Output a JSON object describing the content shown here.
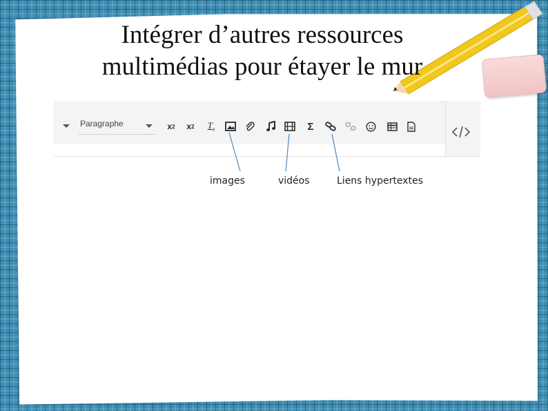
{
  "slide": {
    "title_line1": "Intégrer d’autres ressources",
    "title_line2": "multimédias pour étayer le mur"
  },
  "toolbar": {
    "format_select_value": "Paragraphe",
    "buttons": [
      {
        "name": "subscript",
        "label": "x₂"
      },
      {
        "name": "superscript",
        "label": "x²"
      },
      {
        "name": "clear-format",
        "label": "Tx"
      },
      {
        "name": "image",
        "icon": "image-icon"
      },
      {
        "name": "attachment",
        "icon": "paperclip-icon"
      },
      {
        "name": "audio",
        "icon": "music-note-icon"
      },
      {
        "name": "video",
        "icon": "film-icon"
      },
      {
        "name": "formula",
        "icon": "sigma-icon"
      },
      {
        "name": "link",
        "icon": "link-icon"
      },
      {
        "name": "unlink",
        "icon": "unlink-icon"
      },
      {
        "name": "emoji",
        "icon": "smiley-icon"
      },
      {
        "name": "table",
        "icon": "table-icon"
      },
      {
        "name": "document",
        "icon": "document-icon"
      },
      {
        "name": "html-source",
        "icon": "code-icon"
      }
    ]
  },
  "annotations": {
    "images": "images",
    "videos": "vidéos",
    "links": "Liens hypertextes"
  },
  "colors": {
    "background": "#3e8db3",
    "paper": "#ffffff",
    "callout_line": "#5b8fc0",
    "eraser": "#f5cccc",
    "pencil": "#f2c81a"
  }
}
